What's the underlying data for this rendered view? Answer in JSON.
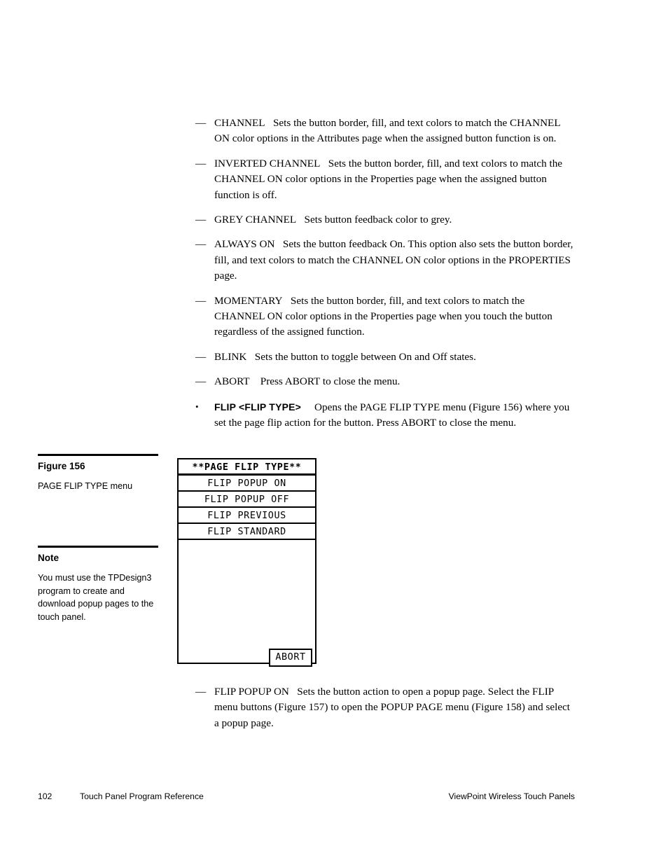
{
  "page": {
    "background_color": "#ffffff",
    "text_color": "#000000"
  },
  "body_items": [
    {
      "marker": "—",
      "term": "CHANNEL",
      "description": "Sets the button border, fill, and text colors to match the CHANNEL ON color options in the Attributes page when the assigned button function is on."
    },
    {
      "marker": "—",
      "term": "INVERTED CHANNEL",
      "description": "Sets the button border, fill, and text colors to match the CHANNEL ON color options in the Properties page when the assigned button function is off."
    },
    {
      "marker": "—",
      "term": "GREY CHANNEL",
      "description": "Sets button feedback color to grey."
    },
    {
      "marker": "—",
      "term": "ALWAYS ON",
      "description": "Sets the button feedback On. This option also sets the button border, fill, and text colors to match the CHANNEL ON color options in the PROPERTIES page."
    },
    {
      "marker": "—",
      "term": "MOMENTARY",
      "description": "Sets the button border, fill, and text colors to match the CHANNEL ON color options in the Properties page when you touch the button regardless of the assigned function."
    },
    {
      "marker": "—",
      "term": "BLINK",
      "description": "Sets the button to toggle between On and Off states."
    },
    {
      "marker": "—",
      "term": "ABORT",
      "description": "Press ABORT to close the menu."
    },
    {
      "marker": "•",
      "term": "FLIP <FLIP TYPE>",
      "term_style": "bold",
      "description": "Opens the PAGE FLIP TYPE menu (Figure 156) where you set the page flip action for the button. Press ABORT to close the menu."
    }
  ],
  "body_items_lower": [
    {
      "marker": "—",
      "term": "FLIP POPUP ON",
      "description": "Sets the button action to open a popup page. Select the FLIP menu buttons (Figure 157) to open the POPUP PAGE menu (Figure 158) and select a popup page."
    }
  ],
  "margin": {
    "figure": {
      "heading": "Figure 156",
      "caption": "PAGE FLIP TYPE menu"
    },
    "note": {
      "heading": "Note",
      "text": "You must use the TPDesign3 program to create and download popup pages to the touch panel."
    }
  },
  "panel": {
    "title": "**PAGE FLIP TYPE**",
    "items": [
      "FLIP POPUP ON",
      "FLIP POPUP OFF",
      "FLIP PREVIOUS",
      "FLIP STANDARD"
    ],
    "abort_label": "ABORT"
  },
  "footer": {
    "page_number": "102",
    "document_title": "Touch Panel Program Reference",
    "product": "ViewPoint Wireless Touch Panels"
  }
}
